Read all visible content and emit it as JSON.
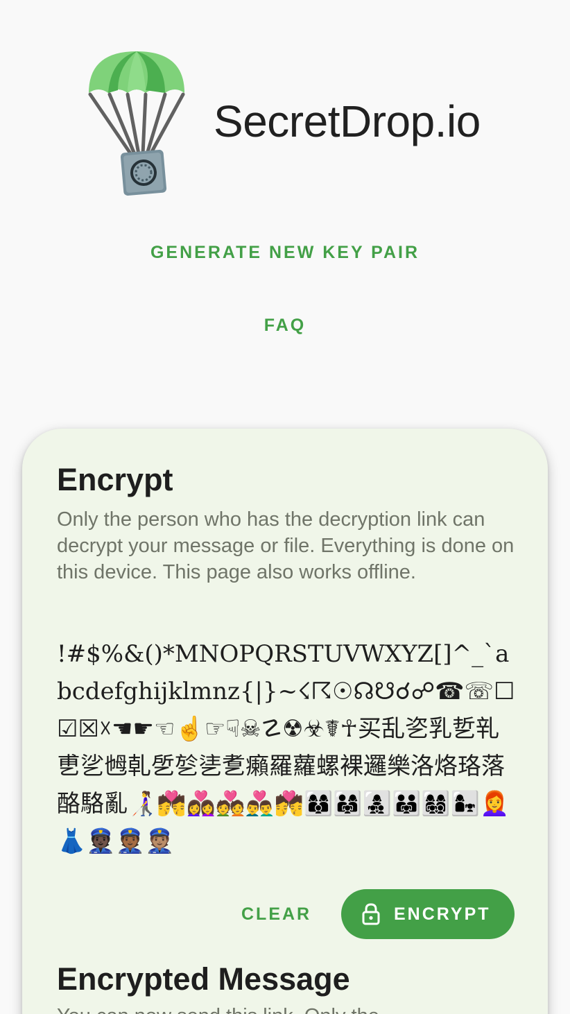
{
  "app": {
    "title": "SecretDrop.io"
  },
  "nav": {
    "generate_label": "GENERATE NEW KEY PAIR",
    "faq_label": "FAQ"
  },
  "encrypt_card": {
    "title": "Encrypt",
    "description": "Only the person who has the decryption link can decrypt your message or file. Everything is done on this device. This page also works offline.",
    "message_value": "!#$%&()*MNOPQRSTUVWXYZ[]^_`abcdefghijklmnz{|}~☇☈☉☊☋☌☍☎☏☐☑☒☓☚☛☜☝☞☟☠☡☢☣☤☥买乱乲乳乴乵乶乷乸乹乺乻乼乽癩羅蘿螺裸邏樂洛烙珞落酪駱亂👩‍🦯💏👩‍❤️‍👩💑👨‍❤️‍👨💏👩‍👩‍👦👨‍👩‍👧👩‍👧‍👦👨‍👨‍👧👩‍👩‍👧‍👦👩‍👧👩‍🦰👗👮🏿👮🏾👮🏽",
    "clear_label": "CLEAR",
    "encrypt_label": "ENCRYPT"
  },
  "encrypted_card": {
    "title": "Encrypted Message",
    "description": "You can now send this link. Only the"
  },
  "colors": {
    "accent": "#43a047",
    "card_bg": "#f0f6e9",
    "page_bg": "#f9f9f9"
  },
  "icons": {
    "logo": "parachute-safe-icon",
    "encrypt": "lock-icon"
  }
}
